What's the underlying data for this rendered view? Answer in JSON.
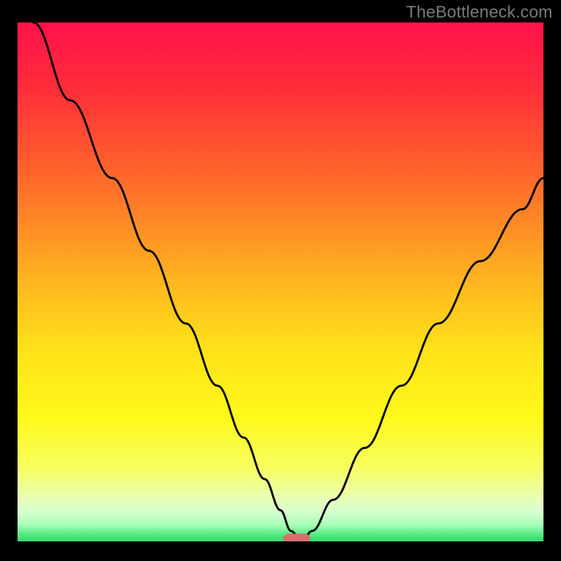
{
  "watermark": "TheBottleneck.com",
  "chart_data": {
    "type": "line",
    "title": "",
    "xlabel": "",
    "ylabel": "",
    "xlim": [
      0,
      100
    ],
    "ylim": [
      0,
      100
    ],
    "gradient_stops": [
      {
        "offset": 0.0,
        "color": "#ff124b"
      },
      {
        "offset": 0.12,
        "color": "#ff2b3a"
      },
      {
        "offset": 0.3,
        "color": "#ff6a2a"
      },
      {
        "offset": 0.48,
        "color": "#ffb120"
      },
      {
        "offset": 0.62,
        "color": "#ffe11a"
      },
      {
        "offset": 0.75,
        "color": "#fff91a"
      },
      {
        "offset": 0.85,
        "color": "#f7ff63"
      },
      {
        "offset": 0.9,
        "color": "#eaffb0"
      },
      {
        "offset": 0.93,
        "color": "#d8ffd0"
      },
      {
        "offset": 0.955,
        "color": "#a8ffb8"
      },
      {
        "offset": 0.975,
        "color": "#4fe87e"
      },
      {
        "offset": 1.0,
        "color": "#18c85a"
      }
    ],
    "series": [
      {
        "name": "bottleneck-curve",
        "x": [
          3,
          10,
          18,
          25,
          32,
          38,
          43,
          47,
          50,
          52,
          54,
          56,
          60,
          66,
          73,
          80,
          88,
          96,
          100
        ],
        "y": [
          100,
          85,
          70,
          56,
          42,
          30,
          20,
          12,
          6,
          2,
          0,
          2,
          8,
          18,
          30,
          42,
          54,
          64,
          70
        ]
      }
    ],
    "marker": {
      "x": 53,
      "y": 0.5,
      "color": "#d96f6e"
    }
  }
}
